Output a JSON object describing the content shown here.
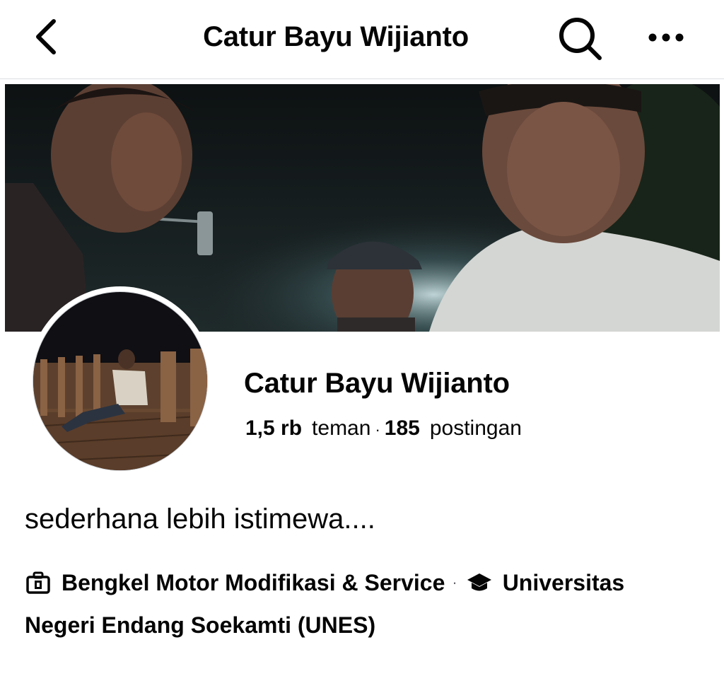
{
  "header": {
    "title": "Catur Bayu Wijianto",
    "back_icon": "chevron-left-icon",
    "search_icon": "search-icon",
    "more_icon": "more-horizontal-icon"
  },
  "profile": {
    "name": "Catur Bayu Wijianto",
    "friends_count": "1,5 rb",
    "friends_label": "teman",
    "separator": "·",
    "posts_count": "185",
    "posts_label": "postingan",
    "bio": "sederhana lebih istimewa....",
    "work": {
      "icon": "briefcase-icon",
      "text": "Bengkel Motor Modifikasi & Service"
    },
    "education": {
      "icon": "graduation-cap-icon",
      "text_line1": "Universitas",
      "text_line2": "Negeri Endang Soekamti (UNES)"
    },
    "details_separator": "·"
  },
  "colors": {
    "text_primary": "#050505",
    "text_secondary": "#65676b",
    "divider": "#dadde1",
    "background": "#ffffff"
  }
}
